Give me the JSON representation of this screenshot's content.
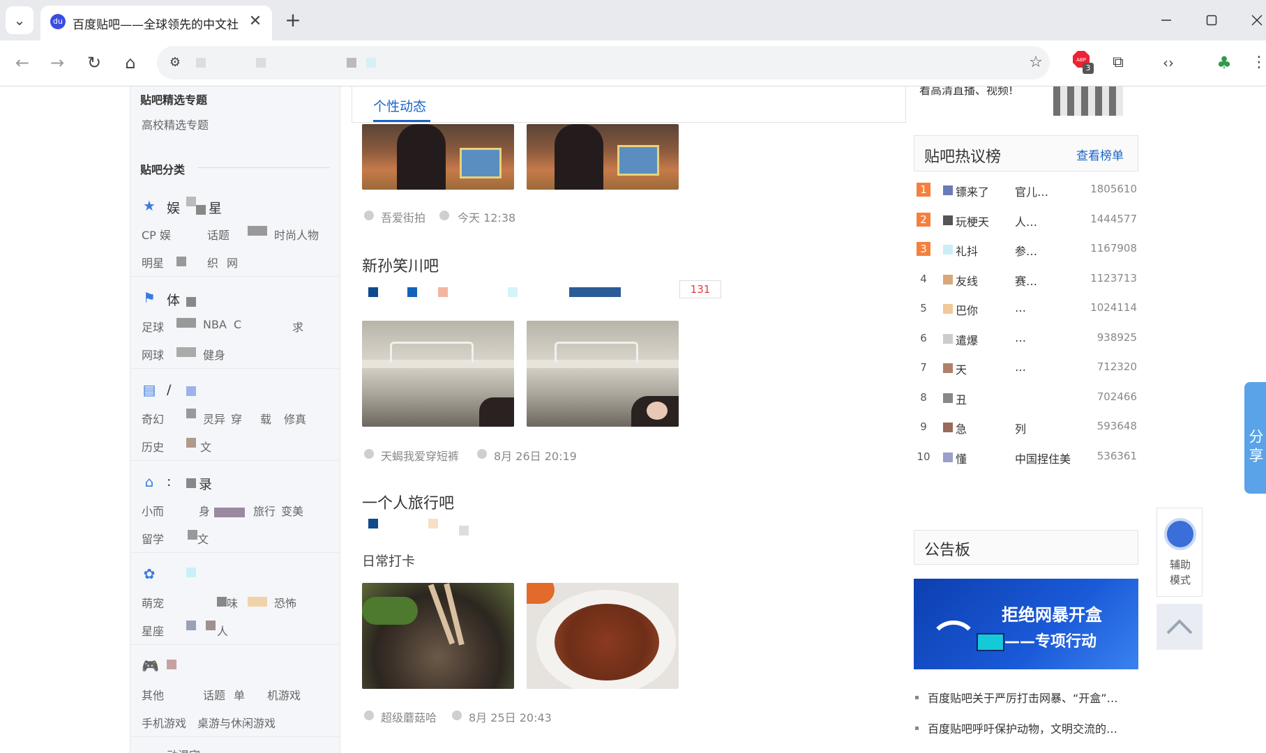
{
  "browser": {
    "tab_title": "百度贴吧——全球领先的中文社",
    "tab_close": "✕",
    "new_tab": "+",
    "tablist_chevron": "⌄",
    "ext_badge": "3"
  },
  "leftnav": {
    "featured_heading": "贴吧精选专题",
    "featured_link": "高校精选专题",
    "category_heading": "贴吧分类",
    "categories": [
      {
        "icon": "star-icon",
        "title_a": "娱",
        "title_b": "星",
        "rows": [
          [
            "CP 娱",
            "话题",
            "时尚人物"
          ],
          [
            "明星",
            "织",
            "网"
          ]
        ]
      },
      {
        "icon": "sports-icon",
        "title_a": "体",
        "title_b": "",
        "rows": [
          [
            "足球",
            "NBA",
            "C",
            "求"
          ],
          [
            "网球",
            "健身"
          ]
        ]
      },
      {
        "icon": "book-icon",
        "title_a": "/",
        "title_b": "",
        "rows": [
          [
            "奇幻",
            "灵异",
            "穿",
            "载",
            "修真"
          ],
          [
            "历史",
            "文"
          ]
        ]
      },
      {
        "icon": "home-icon",
        "title_a": ":",
        "title_b": "录",
        "rows": [
          [
            "小而",
            "身",
            "旅行",
            "变美"
          ],
          [
            "留学",
            "文"
          ]
        ]
      },
      {
        "icon": "butterfly-icon",
        "title_a": "",
        "title_b": "",
        "rows": [
          [
            "萌宠",
            "味",
            "恐怖"
          ],
          [
            "星座",
            "人"
          ]
        ]
      },
      {
        "icon": "gamepad-icon",
        "title_a": "",
        "title_b": "",
        "rows": [
          [
            "其他",
            "话题",
            "单",
            "机游戏"
          ],
          [
            "手机游戏",
            "桌游与休闲游戏"
          ]
        ]
      }
    ],
    "bottom_partial": "动漫宅"
  },
  "feed": {
    "tab_label": "个性动态",
    "posts": [
      {
        "author": "吾爱街拍",
        "time": "今天 12:38"
      },
      {
        "title": "新孙笑川吧",
        "reply_count": "131",
        "author": "天蝎我爱穿短裤",
        "time": "8月 26日 20:19"
      },
      {
        "title": "一个人旅行吧",
        "subtitle": "日常打卡",
        "author": "超级蘑菇哈",
        "time": "8月 25日 20:43"
      }
    ]
  },
  "right": {
    "partial_promo": "看高清直播、视频!",
    "hot_title": "贴吧热议榜",
    "hot_more": "查看榜单",
    "hot_list": [
      {
        "rank": "1",
        "title": "镖来了",
        "title2": "官儿…",
        "count": "1805610"
      },
      {
        "rank": "2",
        "title": "玩梗天",
        "title2": "人…",
        "count": "1444577"
      },
      {
        "rank": "3",
        "title": "礼抖",
        "title2": "参…",
        "count": "1167908"
      },
      {
        "rank": "4",
        "title": "友线",
        "title2": "赛…",
        "count": "1123713"
      },
      {
        "rank": "5",
        "title": "巴你",
        "title2": "…",
        "count": "1024114"
      },
      {
        "rank": "6",
        "title": "遣爆",
        "title2": "…",
        "count": "938925"
      },
      {
        "rank": "7",
        "title": "天",
        "title2": "…",
        "count": "712320"
      },
      {
        "rank": "8",
        "title": "丑",
        "title2": "",
        "count": "702466"
      },
      {
        "rank": "9",
        "title": "急",
        "title2": "列",
        "count": "593648"
      },
      {
        "rank": "10",
        "title": "懂",
        "title2": "中国捏住美…",
        "count": "536361"
      }
    ],
    "notice_title": "公告板",
    "banner_line1": "拒绝网暴开盒",
    "banner_line2": "——专项行动",
    "notices": [
      "百度贴吧关于严厉打击网暴、“开盒”…",
      "百度贴吧呼吁保护动物，文明交流的…"
    ]
  },
  "widgets": {
    "share": "分享",
    "assist_line1": "辅助",
    "assist_line2": "模式"
  },
  "colors": {
    "accent": "#1a64c8",
    "rank_top": "#f5803e",
    "share_bg": "#5aa3e8",
    "banner_bg": "#1552c8"
  }
}
